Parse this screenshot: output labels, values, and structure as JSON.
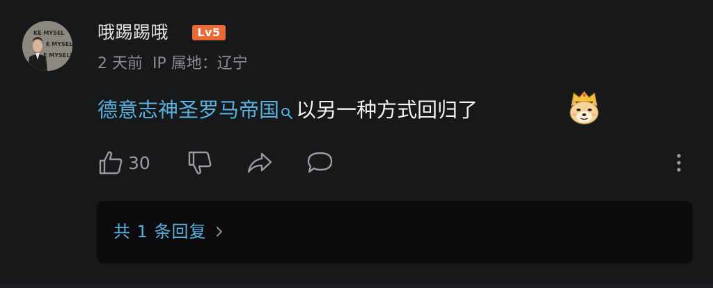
{
  "comment": {
    "username": "哦踢踢哦",
    "level_badge": "Lv5",
    "time_ago": "2 天前",
    "ip_location": "IP 属地：辽宁",
    "topic_link": "德意志神圣罗马帝国",
    "text_suffix": "以另一种方式回归了",
    "emoji_icon": "doge-king-emoji",
    "like_count": "30",
    "reply_summary": "共 1 条回复"
  },
  "colors": {
    "background": "#17181a",
    "link_blue": "#5ab1e0",
    "level_orange": "#ea6a37",
    "meta_gray": "#8b8d91",
    "reply_box": "#0c0c0e"
  },
  "icons": {
    "like": "thumbs-up-icon",
    "dislike": "thumbs-down-icon",
    "share": "share-icon",
    "comment": "comment-bubble-icon",
    "more": "more-vertical-icon",
    "search": "search-icon",
    "chevron": "chevron-right-icon"
  }
}
